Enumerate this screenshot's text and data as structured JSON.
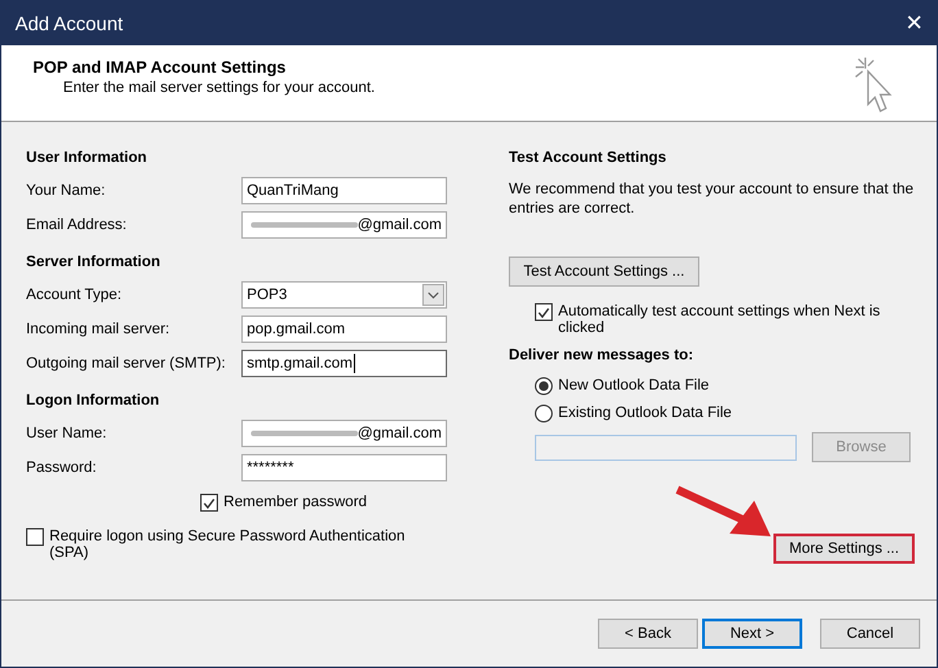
{
  "window": {
    "title": "Add Account",
    "close": "✕"
  },
  "header": {
    "title": "POP and IMAP Account Settings",
    "subtitle": "Enter the mail server settings for your account."
  },
  "left": {
    "groups": [
      {
        "heading": "User Information",
        "fields": [
          {
            "kind": "text",
            "label": "Your Name:",
            "value": "QuanTriMang",
            "redacted": false,
            "focused": false
          },
          {
            "kind": "text",
            "label": "Email Address:",
            "value": "@gmail.com",
            "redacted": true,
            "focused": false
          }
        ]
      },
      {
        "heading": "Server Information",
        "fields": [
          {
            "kind": "dropdown",
            "label": "Account Type:",
            "value": "POP3"
          },
          {
            "kind": "text",
            "label": "Incoming mail server:",
            "value": "pop.gmail.com",
            "redacted": false,
            "focused": false
          },
          {
            "kind": "text",
            "label": "Outgoing mail server (SMTP):",
            "value": "smtp.gmail.com",
            "redacted": false,
            "focused": true
          }
        ]
      },
      {
        "heading": "Logon Information",
        "fields": [
          {
            "kind": "text",
            "label": "User Name:",
            "value": "@gmail.com",
            "redacted": true,
            "focused": false
          },
          {
            "kind": "text",
            "label": "Password:",
            "value": "********",
            "redacted": false,
            "focused": false
          }
        ]
      }
    ],
    "remember": {
      "label": "Remember password",
      "checked": true
    },
    "spa": {
      "label": "Require logon using Secure Password Authentication (SPA)",
      "checked": false
    }
  },
  "right": {
    "heading": "Test Account Settings",
    "description": "We recommend that you test your account to ensure that the entries are correct.",
    "test_button": "Test Account Settings ...",
    "auto_test": {
      "label": "Automatically test account settings when Next is clicked",
      "checked": true
    },
    "deliver_heading": "Deliver new messages to:",
    "options": [
      {
        "label": "New Outlook Data File",
        "selected": true
      },
      {
        "label": "Existing Outlook Data File",
        "selected": false
      }
    ],
    "browse": {
      "label": "Browse",
      "disabled": true
    },
    "more_settings": {
      "label": "More Settings ...",
      "highlighted": true
    }
  },
  "footer": {
    "buttons": [
      {
        "label": "< Back",
        "default": false
      },
      {
        "label": "Next >",
        "default": true
      },
      {
        "label": "Cancel",
        "default": false
      }
    ]
  }
}
